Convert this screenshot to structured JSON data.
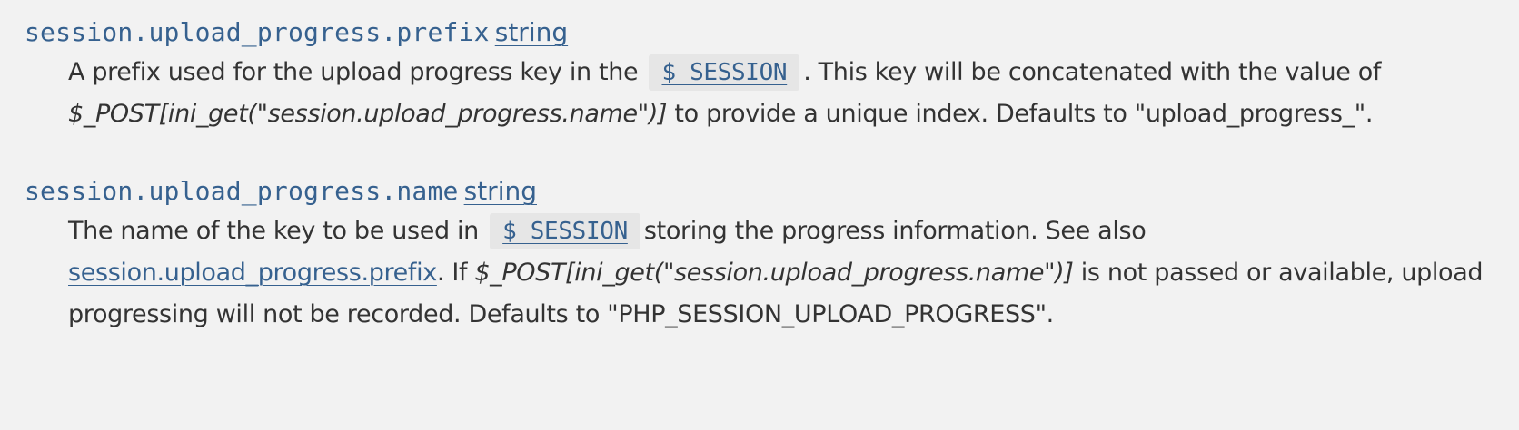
{
  "colors": {
    "background": "#f2f2f2",
    "text": "#333333",
    "link": "#36618f",
    "code_chip_bg": "#e6e6e6"
  },
  "entries": [
    {
      "name": "session.upload_progress.prefix",
      "type": "string",
      "desc_1": "A prefix used for the upload progress key in the",
      "chip": "$_SESSION",
      "desc_2": ". This key will be concatenated with the value of ",
      "italic_1": "$_POST[ini_get(\"session.upload_progress.name\")]",
      "desc_3": " to provide a unique index. Defaults to \"upload_progress_\"."
    },
    {
      "name": "session.upload_progress.name",
      "type": "string",
      "desc_1": "The name of the key to be used in",
      "chip": "$_SESSION",
      "desc_2": "storing the progress information. See also ",
      "link": "session.upload_progress.prefix",
      "desc_3": ". If ",
      "italic_1": "$_POST[ini_get(\"session.upload_progress.name\")]",
      "desc_4": " is not passed or available, upload progressing will not be recorded. Defaults to \"PHP_SESSION_UPLOAD_PROGRESS\"."
    }
  ]
}
